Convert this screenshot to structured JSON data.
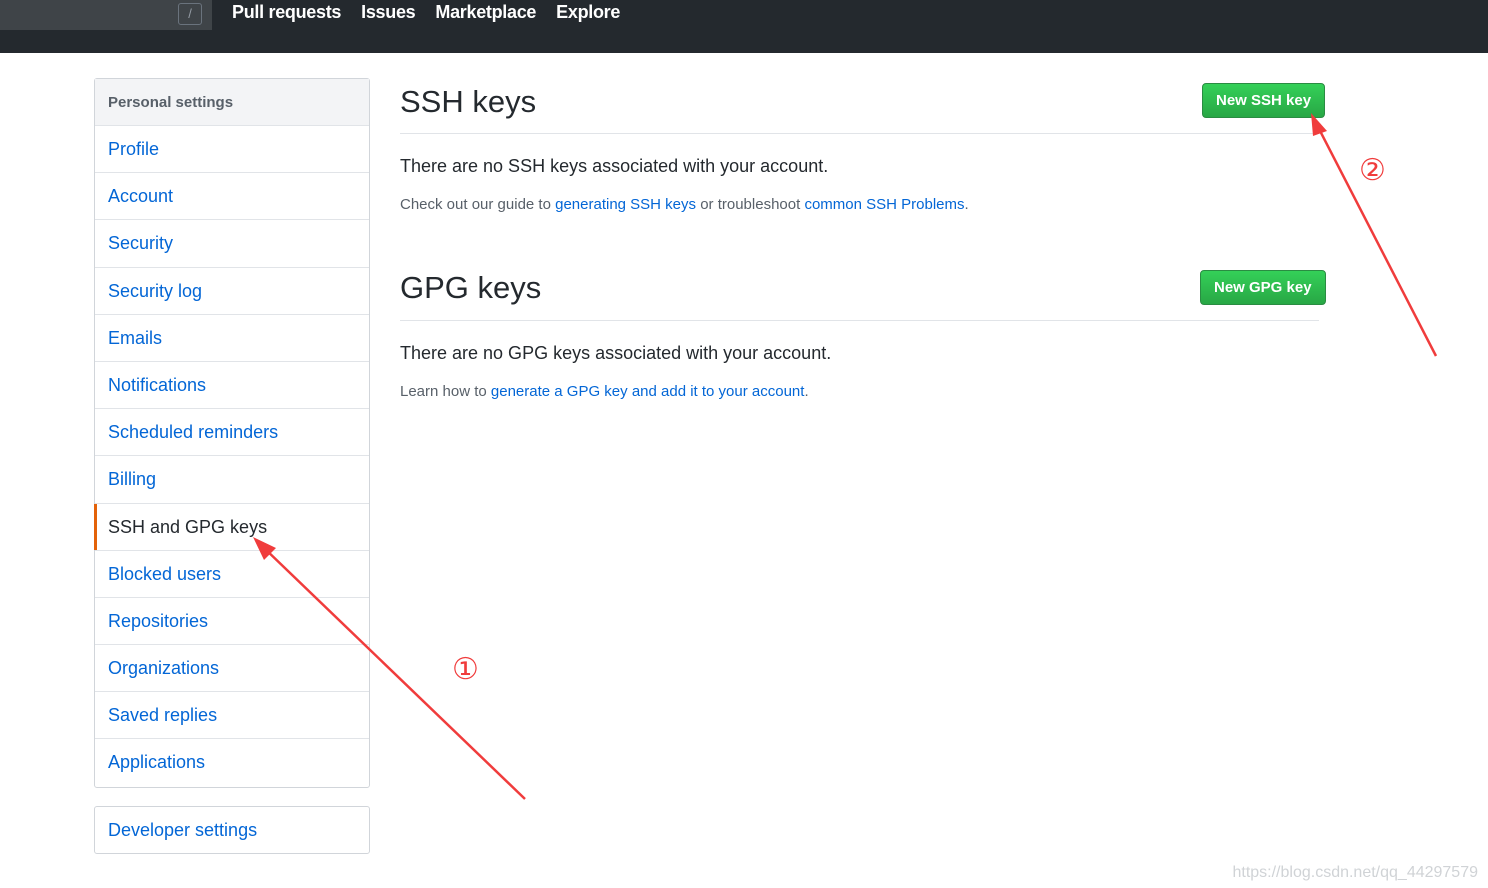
{
  "header": {
    "search_key": "/",
    "nav": [
      "Pull requests",
      "Issues",
      "Marketplace",
      "Explore"
    ]
  },
  "sidebar": {
    "heading": "Personal settings",
    "items": [
      {
        "label": "Profile"
      },
      {
        "label": "Account"
      },
      {
        "label": "Security"
      },
      {
        "label": "Security log"
      },
      {
        "label": "Emails"
      },
      {
        "label": "Notifications"
      },
      {
        "label": "Scheduled reminders"
      },
      {
        "label": "Billing"
      },
      {
        "label": "SSH and GPG keys",
        "selected": true
      },
      {
        "label": "Blocked users"
      },
      {
        "label": "Repositories"
      },
      {
        "label": "Organizations"
      },
      {
        "label": "Saved replies"
      },
      {
        "label": "Applications"
      }
    ],
    "developer": "Developer settings",
    "selected_color": "#e36209"
  },
  "ssh": {
    "title": "SSH keys",
    "button": "New SSH key",
    "empty": "There are no SSH keys associated with your account.",
    "note_prefix": "Check out our guide to ",
    "note_link1": "generating SSH keys",
    "note_middle": " or troubleshoot ",
    "note_link2": "common SSH Problems",
    "note_suffix": "."
  },
  "gpg": {
    "title": "GPG keys",
    "button": "New GPG key",
    "empty": "There are no GPG keys associated with your account.",
    "note_prefix": "Learn how to ",
    "note_link": "generate a GPG key and add it to your account",
    "note_suffix": "."
  },
  "annotations": {
    "step1": "①",
    "step2": "②",
    "arrow_color": "#f03c3c"
  },
  "watermark": "https://blog.csdn.net/qq_44297579",
  "colors": {
    "header_bg": "#24292e",
    "link": "#0366d6",
    "button_green": "#28a745"
  }
}
